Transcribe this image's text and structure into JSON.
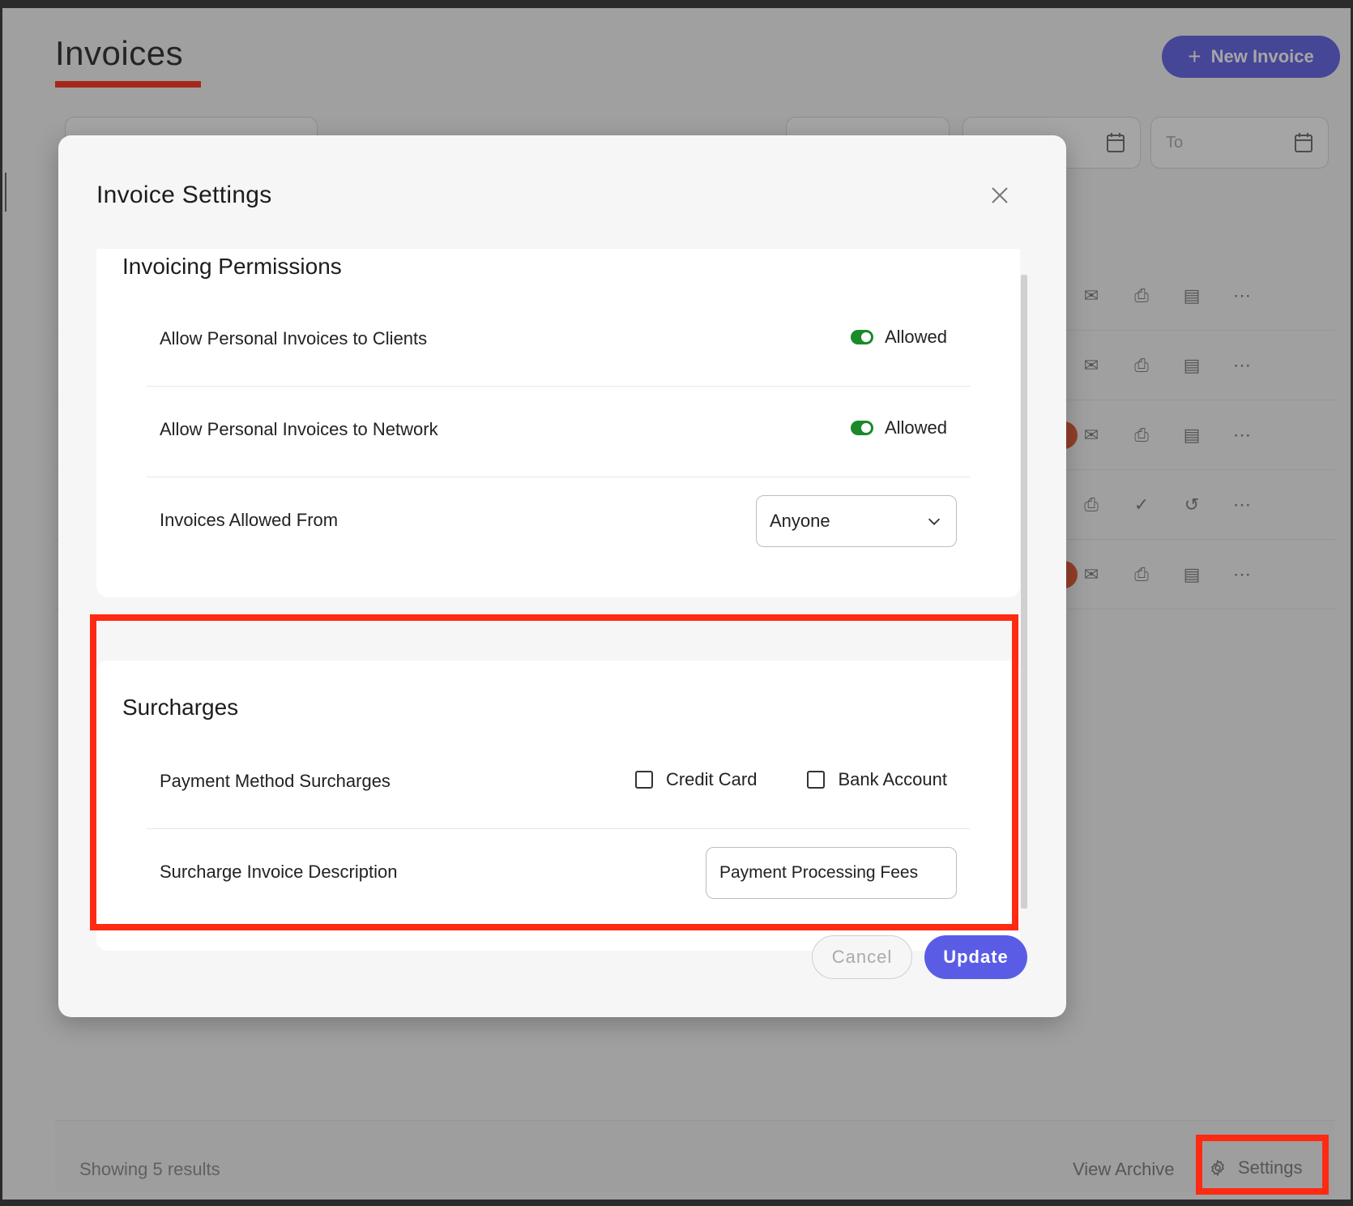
{
  "page": {
    "title": "Invoices",
    "new_invoice_label": "New Invoice",
    "to_placeholder": "To",
    "footer_count": "Showing 5 results",
    "view_archive_label": "View Archive",
    "settings_label": "Settings"
  },
  "modal": {
    "title": "Invoice Settings",
    "permissions": {
      "title": "Invoicing Permissions",
      "rows": [
        {
          "label": "Allow Personal Invoices to Clients",
          "toggle_text": "Allowed"
        },
        {
          "label": "Allow Personal Invoices to Network",
          "toggle_text": "Allowed"
        },
        {
          "label": "Invoices Allowed From",
          "select_value": "Anyone"
        }
      ]
    },
    "surcharges": {
      "title": "Surcharges",
      "method_label": "Payment Method Surcharges",
      "options": [
        "Credit Card",
        "Bank Account"
      ],
      "description_label": "Surcharge Invoice Description",
      "description_value": "Payment Processing Fees"
    },
    "cancel_label": "Cancel",
    "update_label": "Update"
  },
  "colors": {
    "accent": "#5a5ce6",
    "toggle_on": "#1a8a2a",
    "highlight": "#ff2a12"
  }
}
